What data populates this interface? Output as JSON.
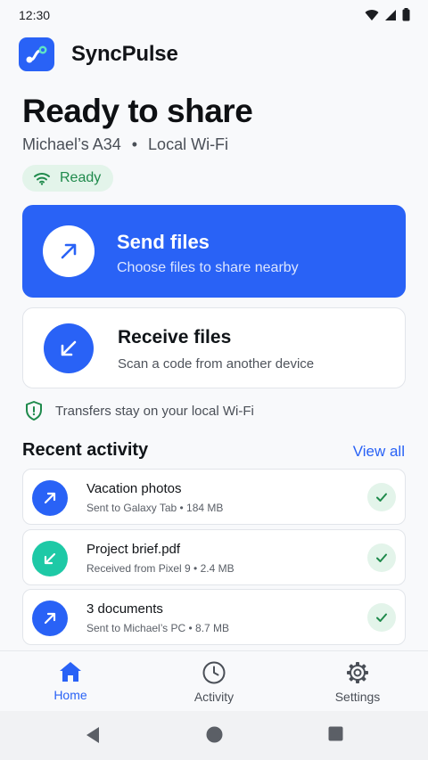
{
  "status_bar": {
    "time": "12:30"
  },
  "app": {
    "name": "SyncPulse"
  },
  "header": {
    "title": "Ready to share",
    "device": "Michael’s A34",
    "separator": "•",
    "network": "Local Wi-Fi",
    "status": "Ready"
  },
  "actions": {
    "send": {
      "title": "Send files",
      "subtitle": "Choose files to share nearby"
    },
    "receive": {
      "title": "Receive files",
      "subtitle": "Scan a code from another device"
    }
  },
  "security_note": "Transfers stay on your local Wi-Fi",
  "recent": {
    "title": "Recent activity",
    "view_all": "View all",
    "items": [
      {
        "name": "Vacation photos",
        "meta": "Sent to Galaxy Tab • 184 MB",
        "direction": "sent",
        "status": "done"
      },
      {
        "name": "Project brief.pdf",
        "meta": "Received from Pixel 9 • 2.4 MB",
        "direction": "received",
        "status": "done"
      },
      {
        "name": "3 documents",
        "meta": "Sent to Michael’s PC • 8.7 MB",
        "direction": "sent",
        "status": "done"
      }
    ]
  },
  "bottom_nav": {
    "items": [
      {
        "label": "Home",
        "icon": "home-icon",
        "active": true
      },
      {
        "label": "Activity",
        "icon": "clock-icon",
        "active": false
      },
      {
        "label": "Settings",
        "icon": "gear-icon",
        "active": false
      }
    ]
  },
  "colors": {
    "primary": "#2962f6",
    "success": "#1f8a4c",
    "success_bg": "#e3f4ea",
    "received": "#1ec9a6"
  }
}
